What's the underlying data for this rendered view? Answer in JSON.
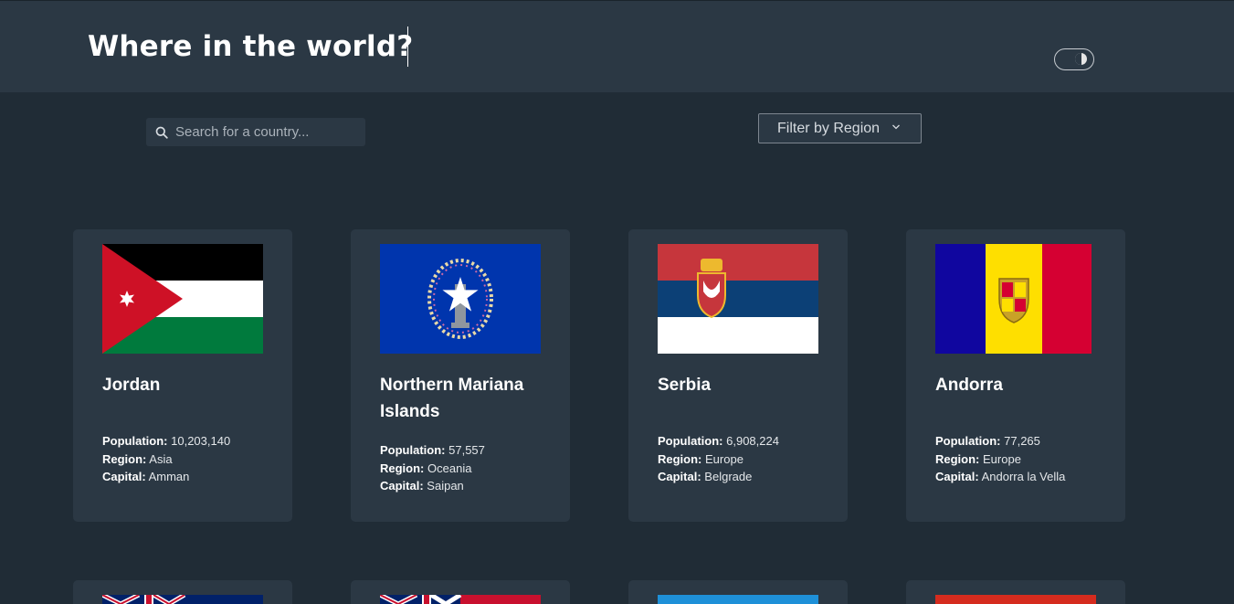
{
  "header": {
    "title": "Where in the world?"
  },
  "search": {
    "placeholder": "Search for a country..."
  },
  "filter": {
    "label": "Filter by Region"
  },
  "labels": {
    "population": "Population:",
    "region": "Region:",
    "capital": "Capital:"
  },
  "countries": [
    {
      "name": "Jordan",
      "population": "10,203,140",
      "region": "Asia",
      "capital": "Amman"
    },
    {
      "name": "Northern Mariana Islands",
      "population": "57,557",
      "region": "Oceania",
      "capital": "Saipan"
    },
    {
      "name": "Serbia",
      "population": "6,908,224",
      "region": "Europe",
      "capital": "Belgrade"
    },
    {
      "name": "Andorra",
      "population": "77,265",
      "region": "Europe",
      "capital": "Andorra la Vella"
    }
  ],
  "colors": {
    "background": "#202c36",
    "element": "#2b3844",
    "text": "#ffffff"
  }
}
